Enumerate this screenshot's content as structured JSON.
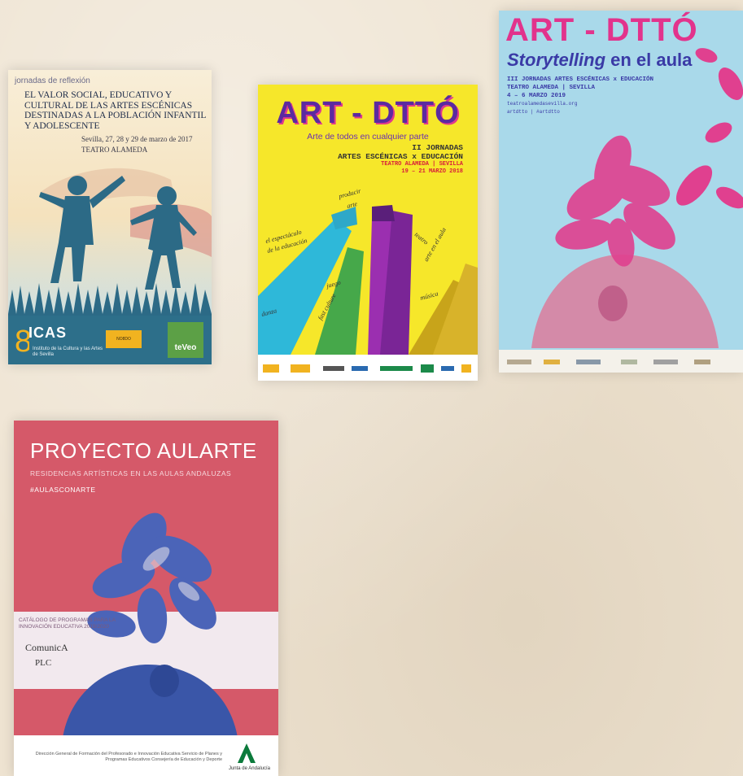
{
  "poster1": {
    "kicker": "jornadas de reflexión",
    "title": "EL VALOR SOCIAL, EDUCATIVO Y CULTURAL DE LAS ARTES ESCÉNICAS DESTINADAS A LA POBLACIÓN INFANTIL Y ADOLESCENTE",
    "dates": "Sevilla, 27, 28 y 29 de marzo de 2017",
    "venue": "TEATRO ALAMEDA",
    "logo_icas": "ICAS",
    "logo_icas_sub": "Instituto de la Cultura y las Artes de Sevilla",
    "logo_teveo": "teVeo",
    "colors": {
      "footer": "#2d6f8a",
      "silhouette": "#2c6a86"
    }
  },
  "poster2": {
    "title": "ART - DTTÓ",
    "subtitle": "Arte de todos en cualquier parte",
    "line1": "II JORNADAS",
    "line2": "ARTES ESCÉNICAS x EDUCACIÓN",
    "line3": "TEATRO ALAMEDA | SEVILLA",
    "line4": "19 – 21 MARZO 2018",
    "words": [
      "producir arte",
      "el espectáculo de la educación",
      "teatro",
      "arte en el aula",
      "juego",
      "danza",
      "música",
      "fast culture"
    ],
    "colors": {
      "bg": "#f6e72a",
      "title": "#5b2aa0"
    }
  },
  "poster3": {
    "title": "ART - DTTÓ",
    "subtitle_italic": "Storytelling",
    "subtitle_rest": "en el aula",
    "line1": "III JORNADAS ARTES ESCÉNICAS x EDUCACIÓN",
    "line2": "TEATRO ALAMEDA | SEVILLA",
    "line3": "4 – 6 MARZO 2019",
    "line4": "teatroalamedasevilla.org",
    "line5": "artdtto | #artdtto",
    "colors": {
      "bg": "#a9d9ea",
      "title": "#e2338c"
    }
  },
  "poster4": {
    "title": "PROYECTO AULARTE",
    "subtitle": "RESIDENCIAS ARTÍSTICAS EN LAS AULAS ANDALUZAS",
    "hashtag": "#AULASCONARTE",
    "catalog": "CATÁLOGO DE PROGRAMAS PARA LA INNOVACIÓN EDUCATIVA 2019/2020",
    "program1": "ComunicA",
    "program2": "PLC",
    "footer": "Dirección General de Formación del Profesorado e Innovación Educativa Servicio de Planes y Programas Educativos Consejería de Educación y Deporte",
    "junta": "Junta de Andalucía",
    "colors": {
      "bg": "#d55969",
      "figure": "#3a56a8"
    }
  }
}
